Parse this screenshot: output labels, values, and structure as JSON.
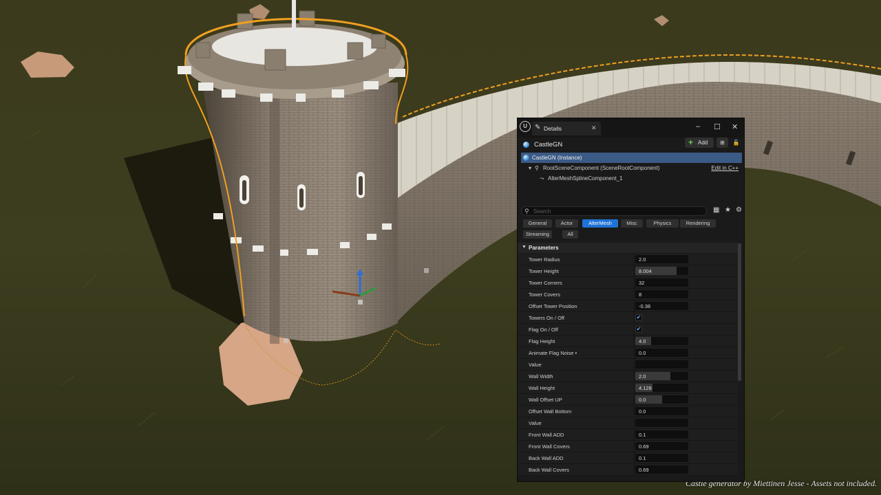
{
  "caption": "Castle generator by Miettinen Jesse - Assets not included.",
  "colors": {
    "selection": "#3c5a86",
    "accent": "#1f73d6",
    "add_plus": "#6ecb4f",
    "outline": "#f0a020"
  },
  "details": {
    "logo": "U",
    "tab_label": "Details",
    "controls": {
      "minimize": "–",
      "maximize": "☐",
      "close": "✕"
    },
    "actor_name": "CastleGN",
    "add_label": "Add",
    "tree": {
      "root": "CastleGN (Instance)",
      "scene_root": "RootSceneComponent (SceneRootComponent)",
      "edit_link": "Edit in C++",
      "spline": "AlterMeshSplineComponent_1"
    },
    "search_placeholder": "Search",
    "categories": [
      "General",
      "Actor",
      "AlterMesh",
      "Misc",
      "Physics",
      "Rendering",
      "Streaming",
      "All"
    ],
    "active_category": "AlterMesh",
    "section": "Parameters",
    "params": [
      {
        "name": "Tower Radius",
        "value": "2.0",
        "kind": "num",
        "fill": 0.0
      },
      {
        "name": "Tower Height",
        "value": "8.004",
        "kind": "num",
        "fill": 0.78
      },
      {
        "name": "Tower Corners",
        "value": "32",
        "kind": "num",
        "fill": 0.0
      },
      {
        "name": "Tower Covers",
        "value": "8",
        "kind": "num",
        "fill": 0.0
      },
      {
        "name": "Offset Tower Position",
        "value": "-0.38",
        "kind": "num",
        "fill": 0.0
      },
      {
        "name": "Towers On / Off",
        "value": true,
        "kind": "check"
      },
      {
        "name": "Flag On / Off",
        "value": true,
        "kind": "check"
      },
      {
        "name": "Flag Height",
        "value": "4.0",
        "kind": "num",
        "fill": 0.3
      },
      {
        "name": "Animate Flag Noise •",
        "value": "0.0",
        "kind": "num",
        "fill": 0.0
      },
      {
        "name": "Value",
        "value": "",
        "kind": "num",
        "fill": 0.0
      },
      {
        "name": "Wall Width",
        "value": "2.0",
        "kind": "num",
        "fill": 0.66
      },
      {
        "name": "Wall Height",
        "value": "4.128",
        "kind": "num",
        "fill": 0.33
      },
      {
        "name": "Wall Offset UP",
        "value": "0.0",
        "kind": "num",
        "fill": 0.5
      },
      {
        "name": "Offset Wall Bottom",
        "value": "0.0",
        "kind": "num",
        "fill": 0.0
      },
      {
        "name": "Value",
        "value": "",
        "kind": "num",
        "fill": 0.0
      },
      {
        "name": "Front Wall ADD",
        "value": "0.1",
        "kind": "num",
        "fill": 0.0
      },
      {
        "name": "Front Wall Covers",
        "value": "0.69",
        "kind": "num",
        "fill": 0.0
      },
      {
        "name": "Back Wall ADD",
        "value": "0.1",
        "kind": "num",
        "fill": 0.0
      },
      {
        "name": "Back Wall Covers",
        "value": "0.69",
        "kind": "num",
        "fill": 0.0
      }
    ]
  }
}
